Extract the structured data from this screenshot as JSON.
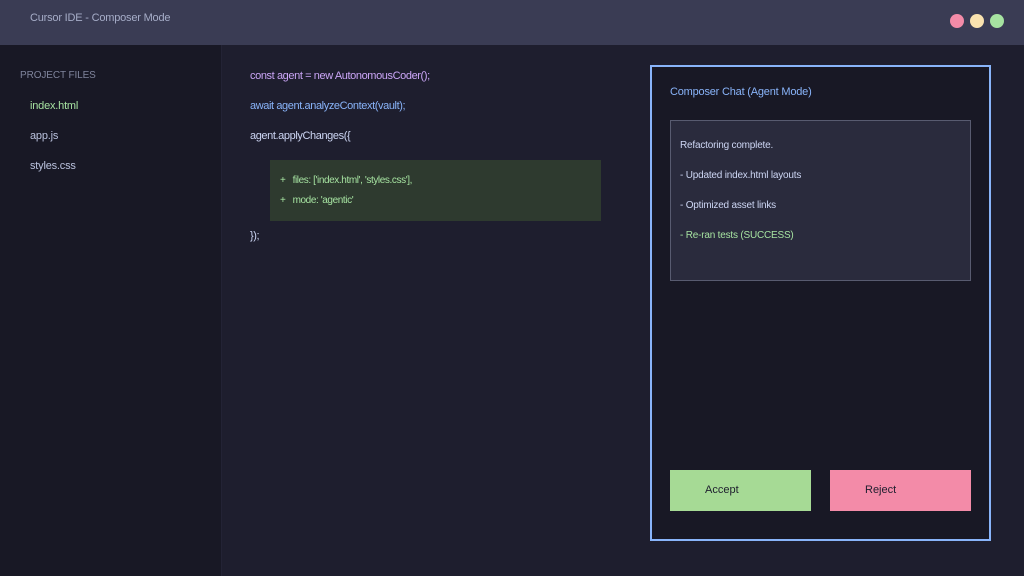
{
  "window": {
    "title": "Cursor IDE - Composer Mode",
    "controls": [
      "close",
      "minimize",
      "maximize"
    ]
  },
  "sidebar": {
    "heading": "PROJECT FILES",
    "files": [
      {
        "label": "index.html",
        "active": true
      },
      {
        "label": "app.js",
        "active": false
      },
      {
        "label": "styles.css",
        "active": false
      }
    ]
  },
  "editor": {
    "lines": [
      "const agent = new AutonomousCoder();",
      "await agent.analyzeContext(vault);",
      "agent.applyChanges({"
    ],
    "diff": [
      "+   files: ['index.html', 'styles.css'],",
      "+   mode: 'agentic'"
    ],
    "closing": "});"
  },
  "composer": {
    "title": "Composer Chat (Agent Mode)",
    "messages": [
      "Refactoring complete.",
      "- Updated index.html layouts",
      "- Optimized asset links",
      "- Re-ran tests (SUCCESS)"
    ],
    "accept_label": "Accept",
    "reject_label": "Reject"
  },
  "colors": {
    "accent": "#89b4fa",
    "success": "#a6e3a1",
    "danger": "#f38ba8",
    "warning": "#f9e2af"
  }
}
